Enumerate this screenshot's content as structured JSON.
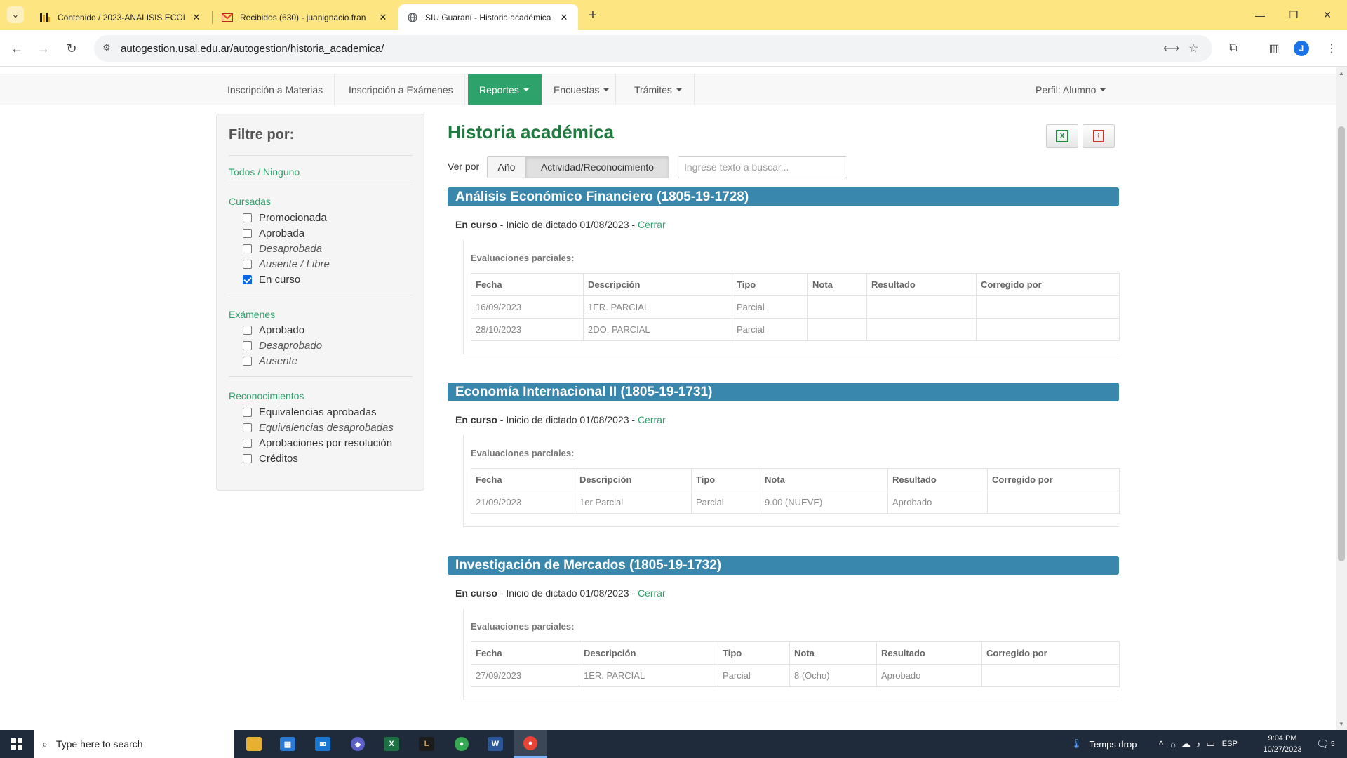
{
  "browser": {
    "tabs": [
      {
        "title": "Contenido / 2023-ANALISIS ECON",
        "favicon": "usal-bars-icon"
      },
      {
        "title": "Recibidos (630) - juanignacio.fran",
        "favicon": "gmail-icon"
      },
      {
        "title": "SIU Guaraní - Historia académica",
        "favicon": "globe-icon",
        "active": true
      }
    ],
    "url": "autogestion.usal.edu.ar/autogestion/historia_academica/",
    "profile_initial": "J"
  },
  "nav": {
    "items": [
      {
        "label": "Inscripción a Materias"
      },
      {
        "label": "Inscripción a Exámenes"
      },
      {
        "label": "Reportes"
      },
      {
        "label": "Encuestas"
      },
      {
        "label": "Trámites"
      }
    ],
    "perfil": "Perfil: Alumno"
  },
  "filter": {
    "title": "Filtre por:",
    "all_none": "Todos / Ninguno",
    "cursadas": {
      "heading": "Cursadas",
      "options": [
        {
          "label": "Promocionada",
          "checked": false
        },
        {
          "label": "Aprobada",
          "checked": false
        },
        {
          "label": "Desaprobada",
          "checked": false
        },
        {
          "label": "Ausente / Libre",
          "checked": false
        },
        {
          "label": "En curso",
          "checked": true
        }
      ]
    },
    "examenes": {
      "heading": "Exámenes",
      "options": [
        {
          "label": "Aprobado",
          "checked": false
        },
        {
          "label": "Desaprobado",
          "checked": false
        },
        {
          "label": "Ausente",
          "checked": false
        }
      ]
    },
    "reconocimientos": {
      "heading": "Reconocimientos",
      "options": [
        {
          "label": "Equivalencias aprobadas",
          "checked": false
        },
        {
          "label": "Equivalencias desaprobadas",
          "checked": false
        },
        {
          "label": "Aprobaciones por resolución",
          "checked": false
        },
        {
          "label": "Créditos",
          "checked": false
        }
      ]
    }
  },
  "main": {
    "title": "Historia académica",
    "ver_por_label": "Ver por",
    "view_options": [
      "Año",
      "Actividad/Reconocimiento"
    ],
    "active_view": "Actividad/Reconocimiento",
    "search_placeholder": "Ingrese texto a buscar...",
    "table_caption": "Evaluaciones parciales:",
    "columns": [
      "Fecha",
      "Descripción",
      "Tipo",
      "Nota",
      "Resultado",
      "Corregido por"
    ],
    "subjects": [
      {
        "name": "Análisis Económico Financiero (1805-19-1728)",
        "status": "En curso",
        "detail": " - Inicio de dictado 01/08/2023 - ",
        "close_link": "Cerrar",
        "rows": [
          [
            "16/09/2023",
            "1ER. PARCIAL",
            "Parcial",
            "",
            "",
            ""
          ],
          [
            "28/10/2023",
            "2DO. PARCIAL",
            "Parcial",
            "",
            "",
            ""
          ]
        ]
      },
      {
        "name": "Economía Internacional II (1805-19-1731)",
        "status": "En curso",
        "detail": " - Inicio de dictado 01/08/2023 - ",
        "close_link": "Cerrar",
        "rows": [
          [
            "21/09/2023",
            "1er Parcial",
            "Parcial",
            "9.00 (NUEVE)",
            "Aprobado",
            ""
          ]
        ]
      },
      {
        "name": "Investigación de Mercados (1805-19-1732)",
        "status": "En curso",
        "detail": " - Inicio de dictado 01/08/2023 - ",
        "close_link": "Cerrar",
        "rows": [
          [
            "27/09/2023",
            "1ER. PARCIAL",
            "Parcial",
            "8 (Ocho)",
            "Aprobado",
            ""
          ]
        ]
      }
    ]
  },
  "taskbar": {
    "search_placeholder": "Type here to search",
    "weather": "Temps drop",
    "language": "ESP",
    "time": "9:04 PM",
    "date": "10/27/2023",
    "notification_count": "5"
  },
  "colors": {
    "tabstrip": "#fde581",
    "nav_active": "#2ea26b",
    "title_green": "#1e7a3e",
    "subject_bar": "#3a87ad"
  }
}
